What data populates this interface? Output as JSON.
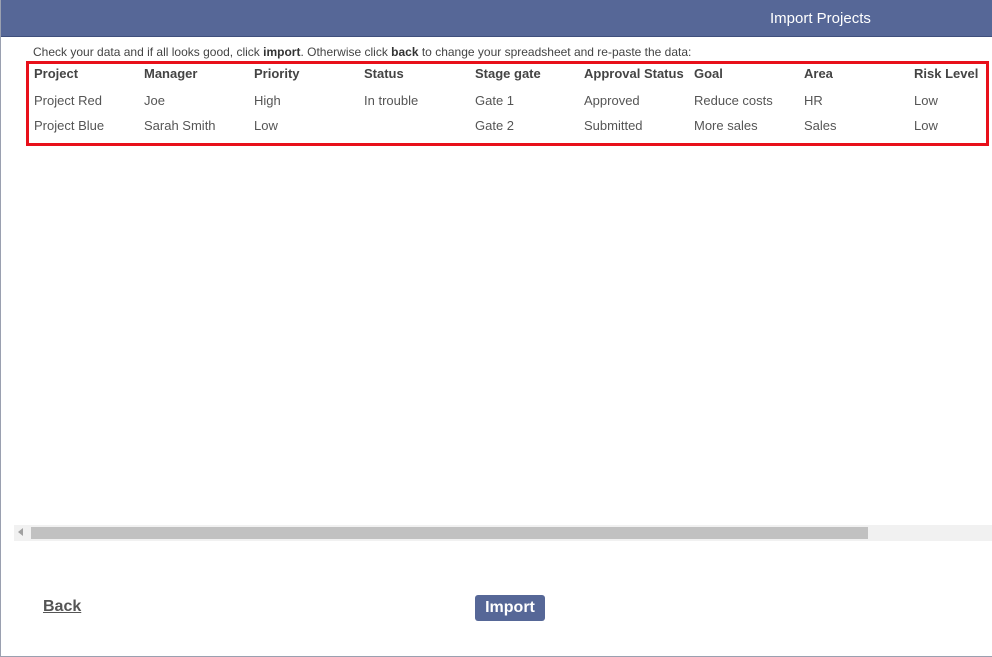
{
  "dialog": {
    "title": "Import Projects"
  },
  "instructions": {
    "part1": "Check your data and if all looks good, click ",
    "import_word": "import",
    "part2": ". Otherwise click ",
    "back_word": "back",
    "part3": " to change your spreadsheet and re-paste the data:"
  },
  "table": {
    "columns": [
      "Project",
      "Manager",
      "Priority",
      "Status",
      "Stage gate",
      "Approval Status",
      "Goal",
      "Area",
      "Risk Level"
    ],
    "rows": [
      [
        "Project Red",
        "Joe",
        "High",
        "In trouble",
        "Gate 1",
        "Approved",
        "Reduce costs",
        "HR",
        "Low"
      ],
      [
        "Project Blue",
        "Sarah Smith",
        "Low",
        "",
        "Gate 2",
        "Submitted",
        "More sales",
        "Sales",
        "Low"
      ]
    ]
  },
  "footer": {
    "back_label": "Back",
    "import_label": "Import"
  },
  "colors": {
    "titlebar": "#566797",
    "highlight_border": "#e8101a",
    "button": "#566797"
  }
}
